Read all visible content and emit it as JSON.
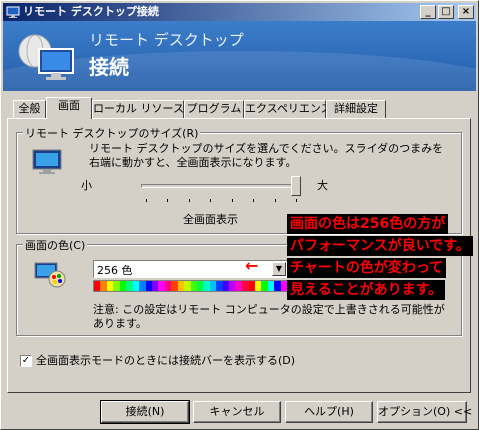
{
  "window": {
    "title": "リモート デスクトップ接続",
    "controls": {
      "minimize": "_",
      "maximize": "□",
      "close": "×"
    }
  },
  "banner": {
    "subtitle": "リモート デスクトップ",
    "title": "接続"
  },
  "tabs": [
    {
      "label": "全般",
      "active": false
    },
    {
      "label": "画面",
      "active": true
    },
    {
      "label": "ローカル リソース",
      "active": false
    },
    {
      "label": "プログラム",
      "active": false
    },
    {
      "label": "エクスペリエンス",
      "active": false
    },
    {
      "label": "詳細設定",
      "active": false
    }
  ],
  "size_group": {
    "label": "リモート デスクトップのサイズ(R)",
    "description": "リモート デスクトップのサイズを選んでください。スライダのつまみを右端に動かすと、全画面表示になります。",
    "slider_min_label": "小",
    "slider_max_label": "大",
    "slider_value_label": "全画面表示",
    "slider_position": 1.0
  },
  "color_group": {
    "label": "画面の色(C)",
    "selected": "256 色",
    "note": "注意: この設定はリモート コンピュータの設定で上書きされる可能性があります。",
    "palette": [
      "#ff0000",
      "#ff8000",
      "#ffff00",
      "#80ff00",
      "#00ff00",
      "#00ff80",
      "#00ffff",
      "#0080ff",
      "#0000ff",
      "#8000ff",
      "#ff00ff",
      "#ff0080",
      "#ff4000",
      "#ffc000",
      "#c0ff00",
      "#40ff00",
      "#00ff40",
      "#00ffc0",
      "#00c0ff",
      "#0040ff",
      "#4000ff",
      "#c000ff",
      "#ff00c0",
      "#ff0040",
      "#ff0000",
      "#ffff00",
      "#00ff00",
      "#00ffff",
      "#0000ff",
      "#ff00ff"
    ]
  },
  "annotation": {
    "lines": [
      "画面の色は256色の方が",
      "パフォーマンスが良いです。",
      "チャートの色が変わって",
      "見えることがあります。"
    ],
    "arrow": "←"
  },
  "checkbox": {
    "label": "全画面表示モードのときには接続バーを表示する(D)",
    "checked": true,
    "mark": "✓"
  },
  "buttons": {
    "connect": "接続(N)",
    "cancel": "キャンセル",
    "help": "ヘルプ(H)",
    "options": "オプション(O) <<"
  }
}
